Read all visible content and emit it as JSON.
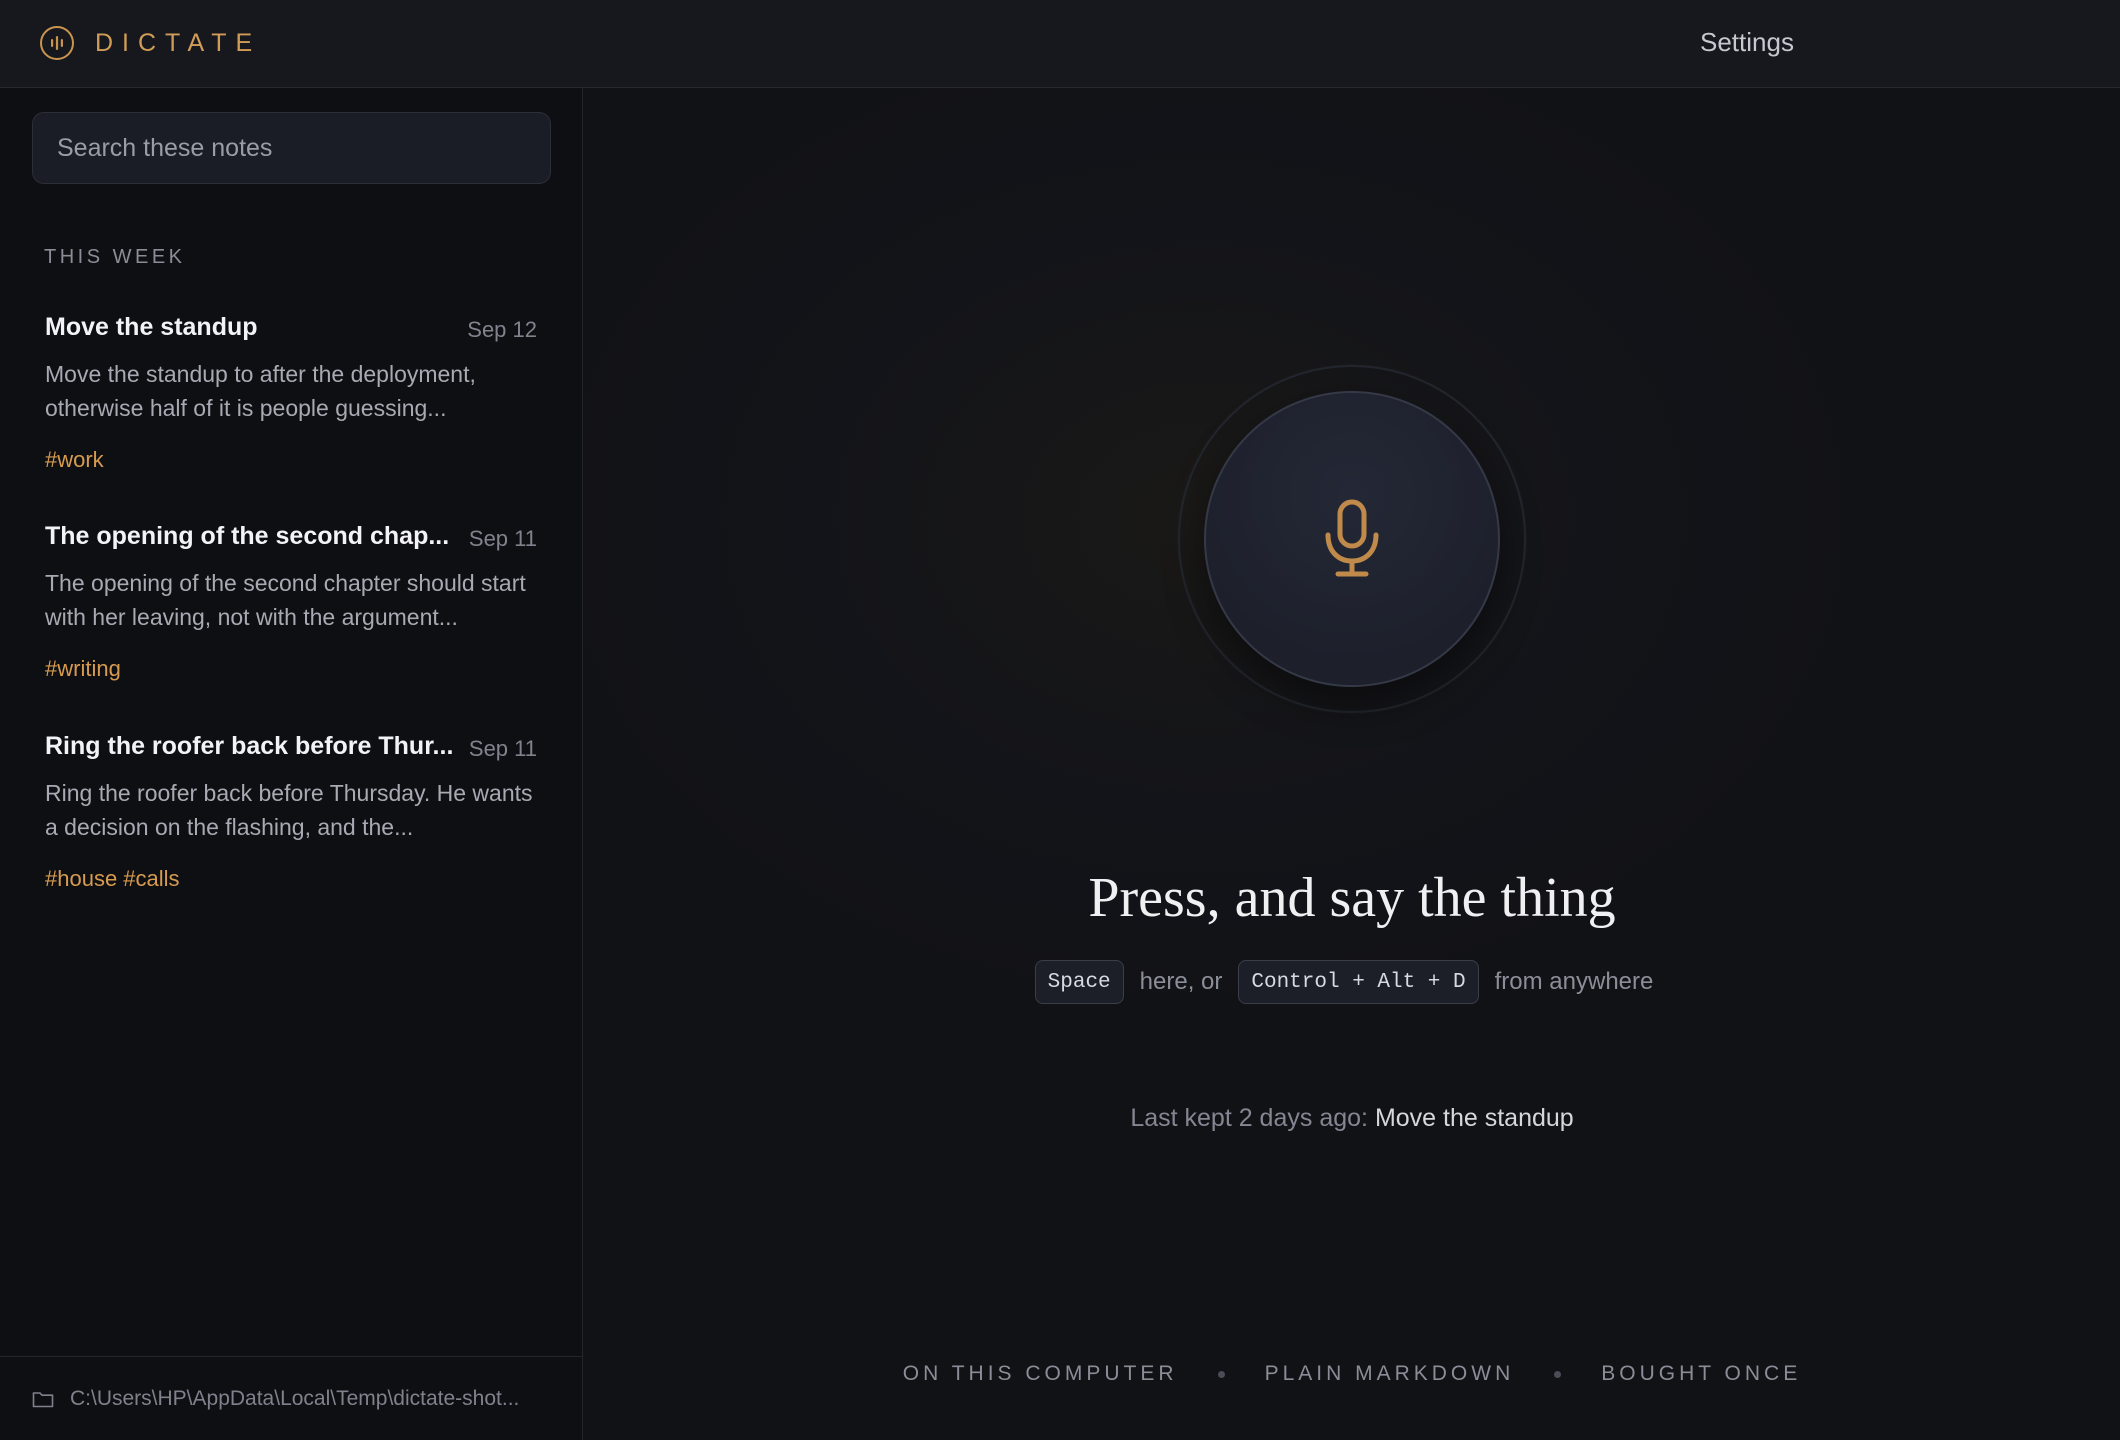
{
  "header": {
    "brand_name": "DICTATE",
    "settings_label": "Settings"
  },
  "sidebar": {
    "search_placeholder": "Search these notes",
    "section_label": "THIS WEEK",
    "notes": [
      {
        "title": "Move the standup",
        "date": "Sep 12",
        "preview": "Move the standup to after the deployment, otherwise half of it is people guessing...",
        "tags": "#work"
      },
      {
        "title": "The opening of the second chap...",
        "date": "Sep 11",
        "preview": "The opening of the second chapter should start with her leaving, not with the argument...",
        "tags": "#writing"
      },
      {
        "title": "Ring the roofer back before Thur...",
        "date": "Sep 11",
        "preview": "Ring the roofer back before Thursday. He wants a decision on the flashing, and the...",
        "tags": "#house #calls"
      }
    ],
    "footer_path": "C:\\Users\\HP\\AppData\\Local\\Temp\\dictate-shot..."
  },
  "main": {
    "headline": "Press, and say the thing",
    "hint": {
      "key_local": "Space",
      "text_middle": "here, or",
      "key_global": "Control + Alt + D",
      "text_end": "from anywhere"
    },
    "last_kept_prefix": "Last kept 2 days ago:",
    "last_kept_link": "Move the standup",
    "badges": [
      "ON THIS COMPUTER",
      "PLAIN MARKDOWN",
      "BOUGHT ONCE"
    ]
  },
  "colors": {
    "accent": "#d19c58",
    "tag": "#d79b4f",
    "background": "#101217"
  },
  "icons": {
    "brand": "waveform-circle-icon",
    "mic": "microphone-icon",
    "folder": "folder-icon"
  }
}
